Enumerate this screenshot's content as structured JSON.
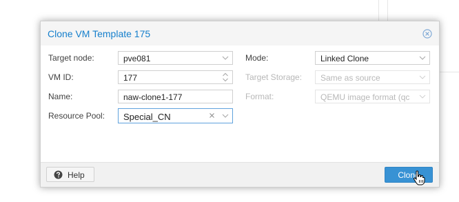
{
  "dialog": {
    "title": "Clone VM Template 175",
    "close_icon": "close-circle-icon"
  },
  "form": {
    "target_node": {
      "label": "Target node:",
      "value": "pve081"
    },
    "vm_id": {
      "label": "VM ID:",
      "value": "177"
    },
    "name": {
      "label": "Name:",
      "value": "naw-clone1-177"
    },
    "resource_pool": {
      "label": "Resource Pool:",
      "value": "Special_CN"
    },
    "mode": {
      "label": "Mode:",
      "value": "Linked Clone"
    },
    "target_storage": {
      "label": "Target Storage:",
      "value": "Same as source"
    },
    "format": {
      "label": "Format:",
      "value": "QEMU image format (qc"
    }
  },
  "footer": {
    "help_label": "Help",
    "help_icon": "question-circle-icon",
    "clone_label": "Clone"
  },
  "colors": {
    "accent": "#157fcc",
    "primary_button": "#3892d4",
    "focus_border": "#5fa2dd"
  }
}
